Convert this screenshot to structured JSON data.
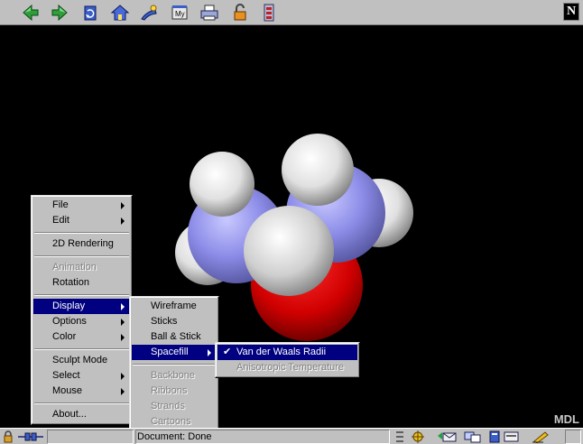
{
  "toolbar": {
    "buttons": [
      {
        "icon": "back-icon"
      },
      {
        "icon": "forward-icon"
      },
      {
        "icon": "reload-icon"
      },
      {
        "icon": "home-icon"
      },
      {
        "icon": "search-icon"
      },
      {
        "icon": "my-netscape-icon",
        "text": "My"
      },
      {
        "icon": "print-icon"
      },
      {
        "icon": "security-icon"
      },
      {
        "icon": "stop-icon"
      }
    ],
    "logo": "N"
  },
  "viewer": {
    "brand": "MDL"
  },
  "main_menu": {
    "items": [
      {
        "label": "File",
        "submenu": true
      },
      {
        "label": "Edit",
        "submenu": true
      },
      {
        "label": "2D Rendering"
      },
      {
        "label": "Animation",
        "disabled": true
      },
      {
        "label": "Rotation"
      },
      {
        "label": "Display",
        "submenu": true,
        "selected": true
      },
      {
        "label": "Options",
        "submenu": true
      },
      {
        "label": "Color",
        "submenu": true
      },
      {
        "label": "Sculpt Mode"
      },
      {
        "label": "Select",
        "submenu": true
      },
      {
        "label": "Mouse",
        "submenu": true
      },
      {
        "label": "About..."
      }
    ]
  },
  "display_menu": {
    "items": [
      {
        "label": "Wireframe"
      },
      {
        "label": "Sticks"
      },
      {
        "label": "Ball & Stick"
      },
      {
        "label": "Spacefill",
        "submenu": true,
        "selected": true
      },
      {
        "label": "Backbone",
        "disabled": true
      },
      {
        "label": "Ribbons",
        "disabled": true
      },
      {
        "label": "Strands",
        "disabled": true
      },
      {
        "label": "Cartoons",
        "disabled": true
      }
    ]
  },
  "spacefill_menu": {
    "items": [
      {
        "label": "Van der Waals Radii",
        "checked": true,
        "selected": true
      },
      {
        "label": "Anisotropic Temperature",
        "disabled": true
      }
    ]
  },
  "statusbar": {
    "text": "Document: Done"
  },
  "colors": {
    "menu_highlight": "#000080",
    "hydrogen": "#ffffff",
    "nitrogen": "#9090ff",
    "oxygen": "#ff0000",
    "carbon": "#c8c8c8"
  }
}
